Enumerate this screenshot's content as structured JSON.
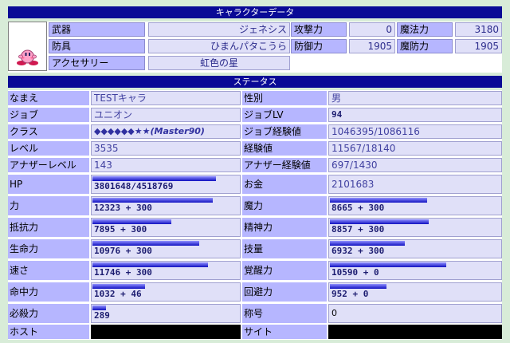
{
  "headers": {
    "character": "キャラクターデータ",
    "status": "ステータス"
  },
  "equipment": {
    "weapon_label": "武器",
    "weapon_value": "ジェネシス",
    "armor_label": "防具",
    "armor_value": "ひまんパタこうら",
    "accessory_label": "アクセサリー",
    "accessory_value": "虹色の星",
    "attack_label": "攻撃力",
    "attack_value": "0",
    "defense_label": "防御力",
    "defense_value": "1905",
    "magic_attack_label": "魔法力",
    "magic_attack_value": "3180",
    "magic_defense_label": "魔防力",
    "magic_defense_value": "1905",
    "portrait_icon": "kirby-portrait-icon"
  },
  "status": {
    "name_label": "なまえ",
    "name_value": "TESTキャラ",
    "sex_label": "性別",
    "sex_value": "男",
    "job_label": "ジョブ",
    "job_value": "ユニオン",
    "joblv_label": "ジョブLV",
    "joblv_value": "94",
    "class_label": "クラス",
    "class_value": "◆◆◆◆◆◆★★(Master90)",
    "jobexp_label": "ジョブ経験値",
    "jobexp_value": "1046395/1086116",
    "level_label": "レベル",
    "level_value": "3535",
    "exp_label": "経験値",
    "exp_value": "11567/18140",
    "another_level_label": "アナザーレベル",
    "another_level_value": "143",
    "another_exp_label": "アナザー経験値",
    "another_exp_value": "697/1430",
    "hp_label": "HP",
    "hp_value": "3801648/4518769",
    "hp_fill": 0.84,
    "money_label": "お金",
    "money_value": "2101683",
    "str_label": "力",
    "str_value": "12323 + 300",
    "str_fill": 0.82,
    "mag_label": "魔力",
    "mag_value": "8665 + 300",
    "mag_fill": 0.57,
    "res_label": "抵抗力",
    "res_value": "7895 + 300",
    "res_fill": 0.54,
    "spi_label": "精神力",
    "spi_value": "8857 + 300",
    "spi_fill": 0.58,
    "vit_label": "生命力",
    "vit_value": "10976 + 300",
    "vit_fill": 0.73,
    "skl_label": "技量",
    "skl_value": "6932 + 300",
    "skl_fill": 0.44,
    "spd_label": "速さ",
    "spd_value": "11746 + 300",
    "spd_fill": 0.79,
    "awk_label": "覚醒力",
    "awk_value": "10590 + 0",
    "awk_fill": 0.68,
    "acc_label": "命中力",
    "acc_value": "1032 + 46",
    "acc_fill": 0.36,
    "eva_label": "回避力",
    "eva_value": "952 + 0",
    "eva_fill": 0.33,
    "crit_label": "必殺力",
    "crit_value": "289",
    "crit_fill": 0.09,
    "title_label": "称号",
    "title_value": "0",
    "host_label": "ホスト",
    "site_label": "サイト"
  }
}
